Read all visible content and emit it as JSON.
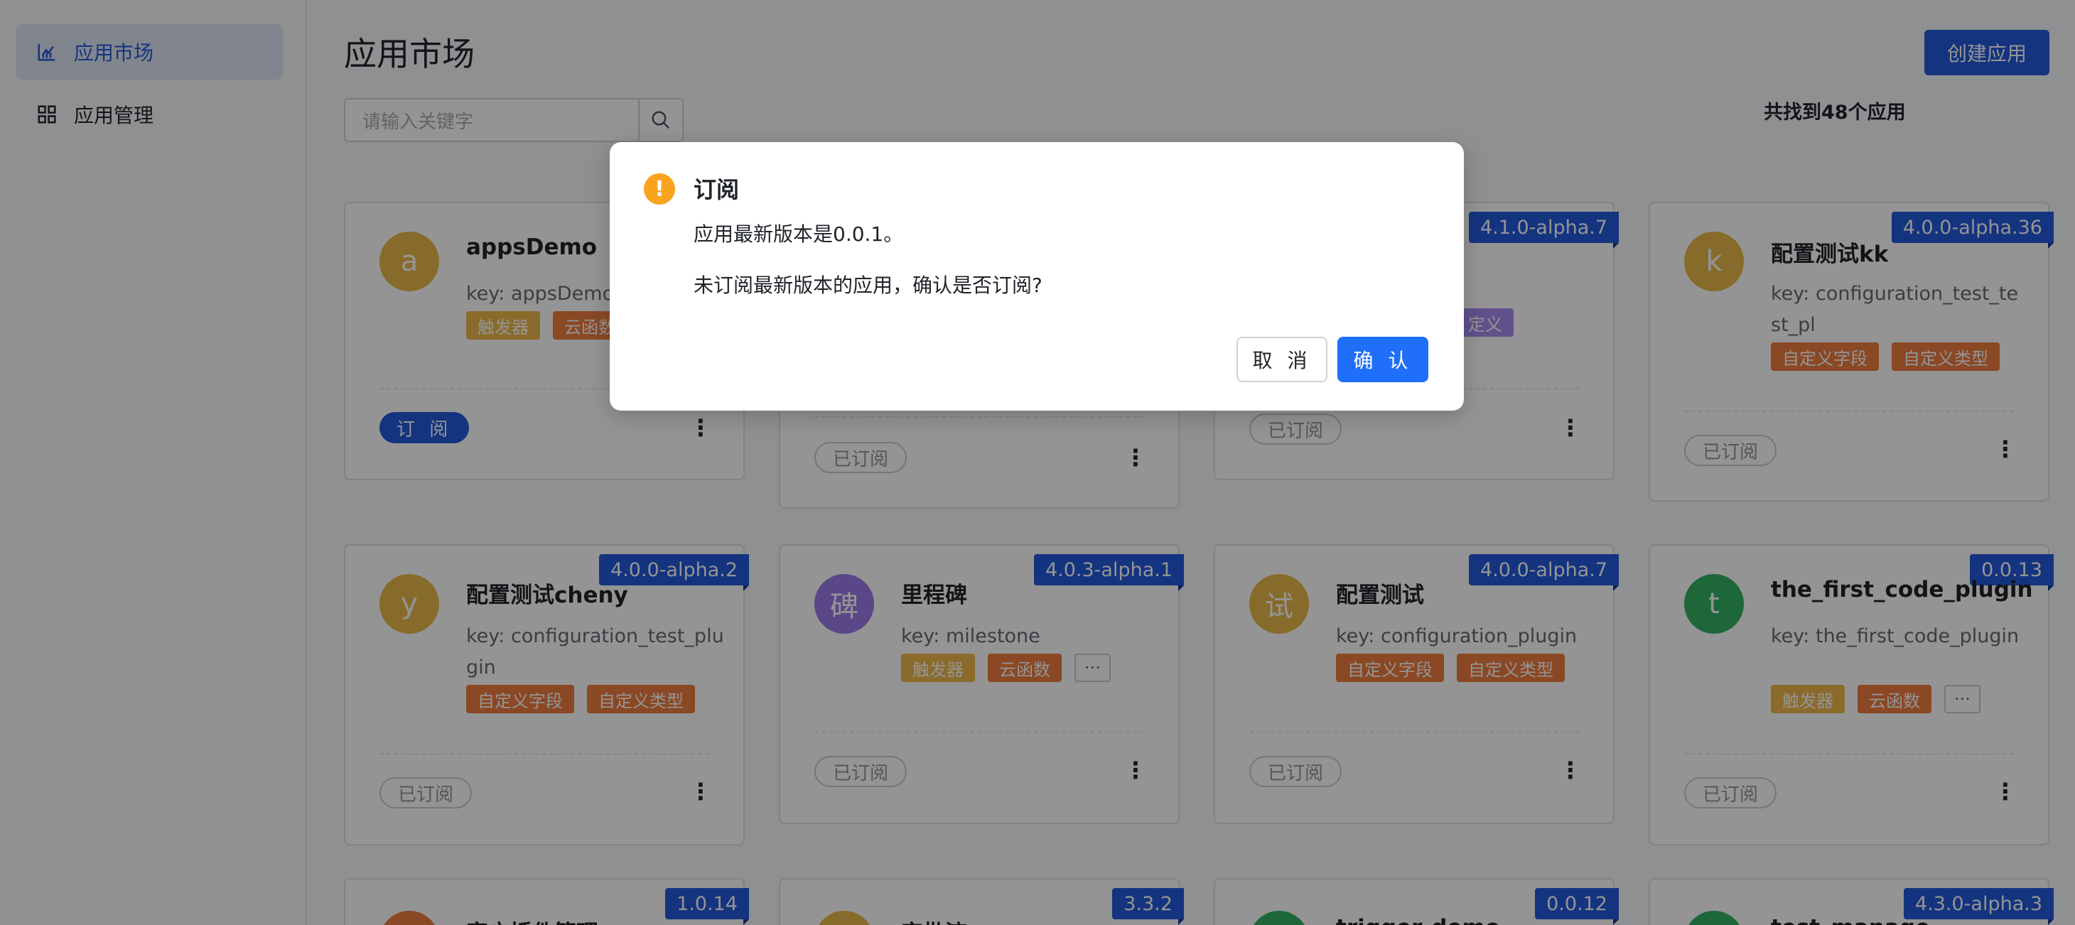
{
  "sidebar": {
    "items": [
      {
        "label": "应用市场",
        "icon": "bar-chart-icon",
        "active": true
      },
      {
        "label": "应用管理",
        "icon": "grid-icon",
        "active": false
      }
    ]
  },
  "header": {
    "title": "应用市场",
    "create_label": "创建应用"
  },
  "search": {
    "placeholder": "请输入关键字",
    "result_count": "共找到48个应用"
  },
  "cards": [
    {
      "name": "appsDemo",
      "key": "key: appsDemo",
      "avatar": "a",
      "avatar_color": "#e9b949",
      "tags": [
        "触发器",
        "云函数"
      ],
      "status": "订 阅",
      "version": ""
    },
    {
      "name": "",
      "key": "",
      "avatar": "",
      "avatar_color": "",
      "tags": [],
      "status": "已订阅",
      "version": ""
    },
    {
      "name": "",
      "key": "",
      "avatar": "",
      "avatar_color": "",
      "tags": [
        "定义"
      ],
      "status": "已订阅",
      "version": "4.1.0-alpha.7"
    },
    {
      "name": "配置测试kk",
      "key": "key: configuration_test_test_pl",
      "avatar": "k",
      "avatar_color": "#e9b949",
      "tags": [
        "自定义字段",
        "自定义类型"
      ],
      "status": "已订阅",
      "version": "4.0.0-alpha.36"
    },
    {
      "name": "配置测试cheny",
      "key": "key: configuration_test_plugin",
      "avatar": "y",
      "avatar_color": "#e9b949",
      "tags": [
        "自定义字段",
        "自定义类型"
      ],
      "status": "已订阅",
      "version": "4.0.0-alpha.2"
    },
    {
      "name": "里程碑",
      "key": "key: milestone",
      "avatar": "碑",
      "avatar_color": "#9b7be8",
      "tags": [
        "触发器",
        "云函数",
        "···"
      ],
      "status": "已订阅",
      "version": "4.0.3-alpha.1"
    },
    {
      "name": "配置测试",
      "key": "key: configuration_plugin",
      "avatar": "试",
      "avatar_color": "#e9b949",
      "tags": [
        "自定义字段",
        "自定义类型"
      ],
      "status": "已订阅",
      "version": "4.0.0-alpha.7"
    },
    {
      "name": "the_first_code_plugin",
      "key": "key: the_first_code_plugin",
      "avatar": "t",
      "avatar_color": "#34b267",
      "tags": [
        "触发器",
        "云函数",
        "···"
      ],
      "status": "已订阅",
      "version": "0.0.13"
    },
    {
      "name": "客户插件管理",
      "key": "",
      "avatar": "",
      "avatar_color": "#ee7c3e",
      "tags": [],
      "status": "",
      "version": "1.0.14"
    },
    {
      "name": "审批流",
      "key": "",
      "avatar": "",
      "avatar_color": "#e9b949",
      "tags": [],
      "status": "",
      "version": "3.3.2"
    },
    {
      "name": "trigger-demo",
      "key": "",
      "avatar": "",
      "avatar_color": "#34b267",
      "tags": [],
      "status": "",
      "version": "0.0.12"
    },
    {
      "name": "test_manage",
      "key": "",
      "avatar": "",
      "avatar_color": "#34b267",
      "tags": [],
      "status": "",
      "version": "4.3.0-alpha.3"
    }
  ],
  "modal": {
    "title": "订阅",
    "line1": "应用最新版本是0.0.1。",
    "line2": "未订阅最新版本的应用，确认是否订阅?",
    "cancel_label": "取 消",
    "confirm_label": "确 认",
    "icon_glyph": "!"
  },
  "colors": {
    "accent": "#245bdb",
    "confirm": "#1f6ff8",
    "warning": "#faa31d"
  }
}
